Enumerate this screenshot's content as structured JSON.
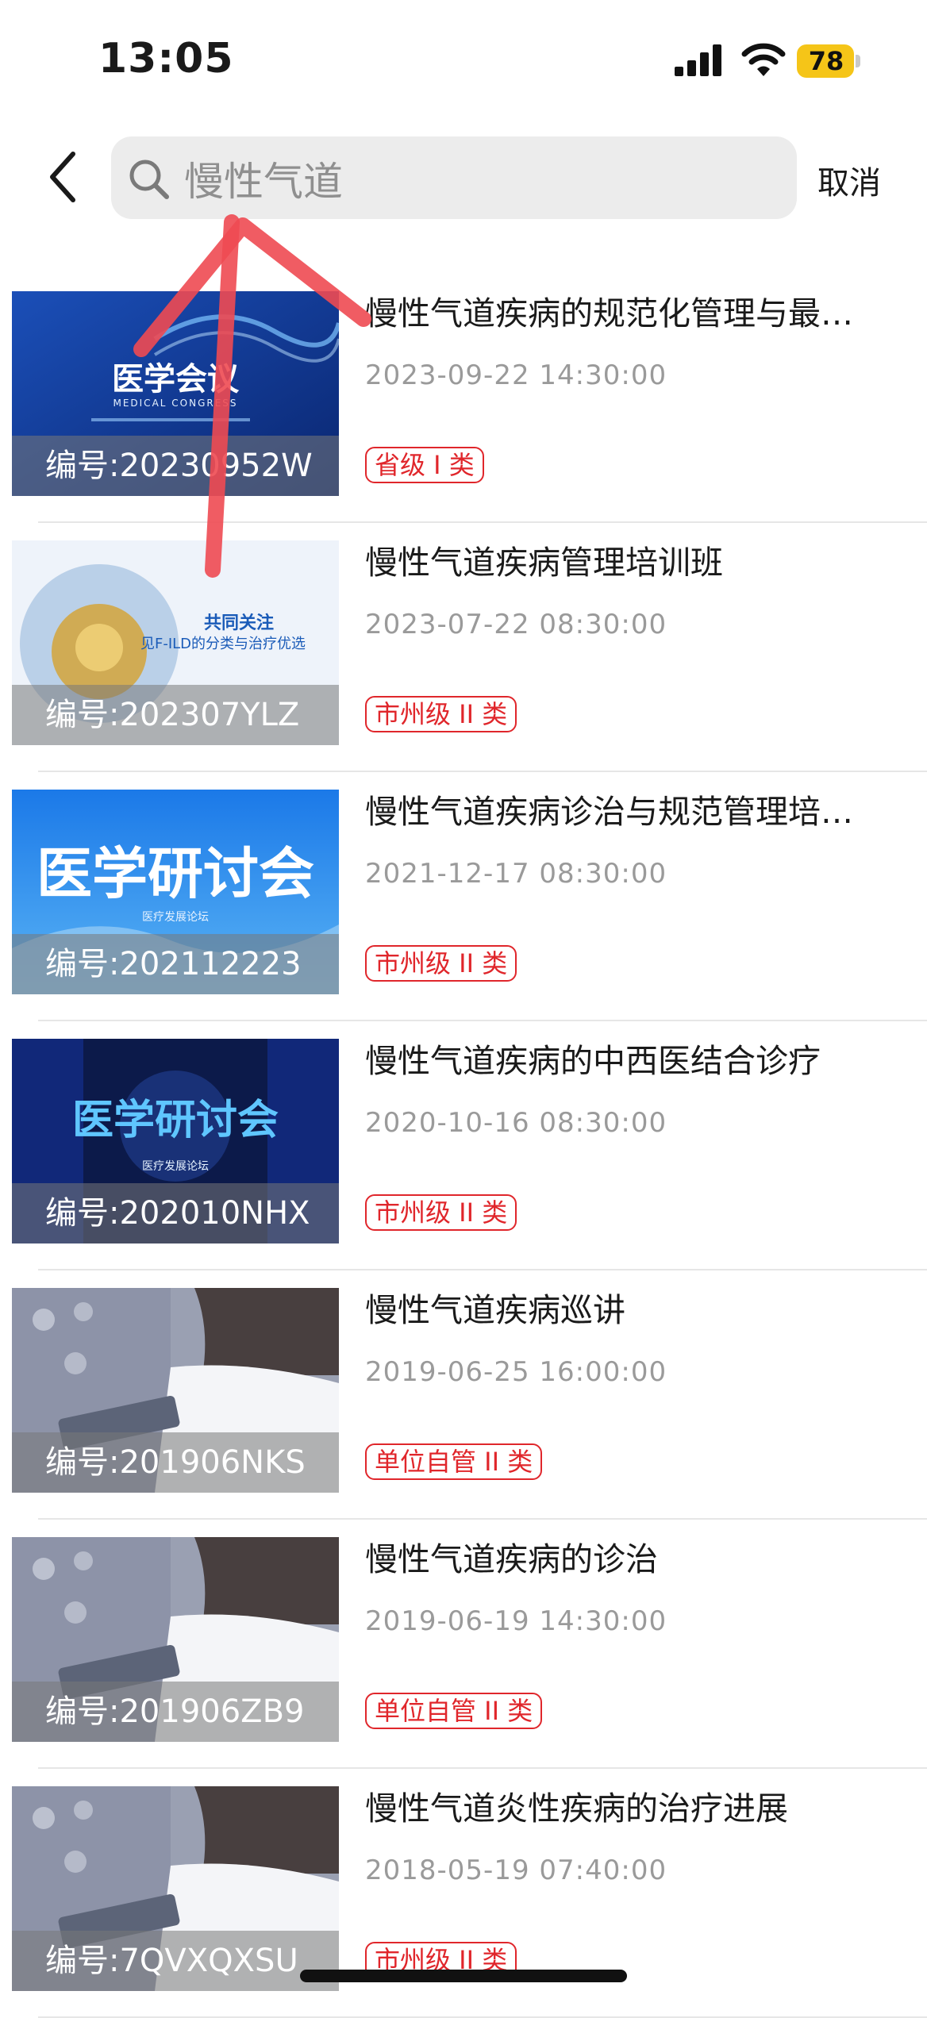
{
  "status": {
    "time": "13:05",
    "battery": "78"
  },
  "search": {
    "value": "慢性气道",
    "cancel_label": "取消"
  },
  "results": [
    {
      "title": "慢性气道疾病的规范化管理与最…",
      "date": "2023-09-22 14:30:00",
      "badge": "省级 I 类",
      "code": "编号:20230952W",
      "thumb_theme": "medical-congress-blue",
      "thumb_text": "医学会议",
      "thumb_subtext": "MEDICAL CONGRESS"
    },
    {
      "title": "慢性气道疾病管理培训班",
      "date": "2023-07-22 08:30:00",
      "badge": "市州级 II 类",
      "code": "编号:202307YLZ",
      "thumb_theme": "lung-ild-light",
      "thumb_text": "共同关注",
      "thumb_subtext": "见F-ILD的分类与治疗优选"
    },
    {
      "title": "慢性气道疾病诊治与规范管理培…",
      "date": "2021-12-17 08:30:00",
      "badge": "市州级 II 类",
      "code": "编号:202112223",
      "thumb_theme": "seminar-blue",
      "thumb_text": "医学研讨会",
      "thumb_subtext": "医疗发展论坛"
    },
    {
      "title": "慢性气道疾病的中西医结合诊疗",
      "date": "2020-10-16 08:30:00",
      "badge": "市州级 II 类",
      "code": "编号:202010NHX",
      "thumb_theme": "seminar-dark",
      "thumb_text": "医学研讨会",
      "thumb_subtext": "医疗发展论坛"
    },
    {
      "title": "慢性气道疾病巡讲",
      "date": "2019-06-25 16:00:00",
      "badge": "单位自管 II 类",
      "code": "编号:201906NKS",
      "thumb_theme": "doctor-tablet",
      "thumb_text": "",
      "thumb_subtext": ""
    },
    {
      "title": "慢性气道疾病的诊治",
      "date": "2019-06-19 14:30:00",
      "badge": "单位自管 II 类",
      "code": "编号:201906ZB9",
      "thumb_theme": "doctor-tablet",
      "thumb_text": "",
      "thumb_subtext": ""
    },
    {
      "title": "慢性气道炎性疾病的治疗进展",
      "date": "2018-05-19 07:40:00",
      "badge": "市州级 II 类",
      "code": "编号:7QVXQXSU",
      "thumb_theme": "doctor-tablet",
      "thumb_text": "",
      "thumb_subtext": ""
    }
  ],
  "colors": {
    "badge_red": "#e0262b",
    "annotation_arrow": "#ee4a52",
    "search_bg": "#ececec",
    "battery_yellow": "#f5c518"
  },
  "icons": {
    "back": "chevron-left-icon",
    "search": "magnifier-icon",
    "signal": "cellular-signal-icon",
    "wifi": "wifi-icon",
    "battery": "battery-charging-icon"
  }
}
